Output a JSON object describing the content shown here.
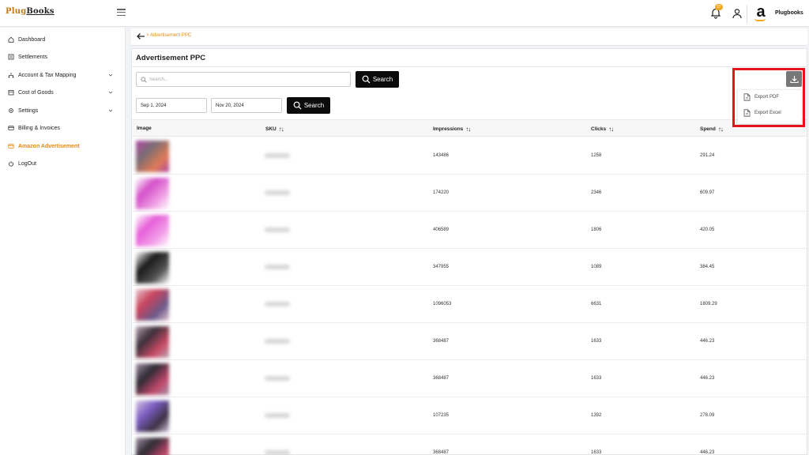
{
  "brand": {
    "name_part1": "Plug",
    "name_part2": "Books"
  },
  "header": {
    "notification_count": "27",
    "account_name": "Plugbooks",
    "amazon_letter": "a"
  },
  "sidebar": {
    "items": [
      {
        "label": "Dashboard",
        "icon": "home-icon",
        "has_chevron": false,
        "active": false
      },
      {
        "label": "Settlements",
        "icon": "receipt-icon",
        "has_chevron": false,
        "active": false
      },
      {
        "label": "Account & Tax Mapping",
        "icon": "sitemap-icon",
        "has_chevron": true,
        "active": false
      },
      {
        "label": "Cost of Goods",
        "icon": "box-icon",
        "has_chevron": true,
        "active": false
      },
      {
        "label": "Settings",
        "icon": "gear-icon",
        "has_chevron": true,
        "active": false
      },
      {
        "label": "Billing & Invoices",
        "icon": "card-icon",
        "has_chevron": false,
        "active": false
      },
      {
        "label": "Amazon Advertisement",
        "icon": "ad-icon",
        "has_chevron": false,
        "active": true
      },
      {
        "label": "LogOut",
        "icon": "power-icon",
        "has_chevron": false,
        "active": false
      }
    ]
  },
  "breadcrumb": {
    "label": "> Advertisement PPC"
  },
  "page": {
    "title": "Advertisement PPC"
  },
  "search": {
    "placeholder": "Search...",
    "value": "",
    "button_label": "Search"
  },
  "date_filter": {
    "start": "Sep 1, 2024",
    "end": "Nov 20, 2024",
    "button_label": "Search"
  },
  "table": {
    "columns": [
      {
        "label": "Image",
        "sortable": false
      },
      {
        "label": "SKU",
        "sortable": true
      },
      {
        "label": "Impressions",
        "sortable": true
      },
      {
        "label": "Clicks",
        "sortable": true
      },
      {
        "label": "Spend",
        "sortable": true
      }
    ],
    "rows": [
      {
        "impressions": "143486",
        "clicks": "1258",
        "spend": "291.24",
        "thumb_colors": [
          "#7a6d74",
          "#e07a55",
          "#b24aa5"
        ]
      },
      {
        "impressions": "174220",
        "clicks": "2346",
        "spend": "609.97",
        "thumb_colors": [
          "#d44fc8",
          "#f0a3e6",
          "#ffffff"
        ]
      },
      {
        "impressions": "406589",
        "clicks": "1806",
        "spend": "420.05",
        "thumb_colors": [
          "#e65fd8",
          "#f3a1ea",
          "#ffffff"
        ]
      },
      {
        "impressions": "347955",
        "clicks": "1089",
        "spend": "384.45",
        "thumb_colors": [
          "#1a1a1a",
          "#555555",
          "#ffffff"
        ]
      },
      {
        "impressions": "1096053",
        "clicks": "6631",
        "spend": "1809.29",
        "thumb_colors": [
          "#c9435c",
          "#6c5a8a",
          "#e6c6cf"
        ]
      },
      {
        "impressions": "368487",
        "clicks": "1633",
        "spend": "446.23",
        "thumb_colors": [
          "#3a2f3a",
          "#c74a63",
          "#bda6b6"
        ]
      },
      {
        "impressions": "368487",
        "clicks": "1633",
        "spend": "446.23",
        "thumb_colors": [
          "#2e2a33",
          "#c0486b",
          "#a592a8"
        ]
      },
      {
        "impressions": "107235",
        "clicks": "1392",
        "spend": "278.09",
        "thumb_colors": [
          "#7b5ec2",
          "#3c3142",
          "#d7c6e4"
        ]
      },
      {
        "impressions": "368487",
        "clicks": "1633",
        "spend": "446.23",
        "thumb_colors": [
          "#2e2a33",
          "#c0486b",
          "#a592a8"
        ]
      }
    ]
  },
  "export": {
    "items": [
      {
        "label": "Export PDF",
        "icon": "pdf-file-icon"
      },
      {
        "label": "Export Excel",
        "icon": "excel-file-icon"
      }
    ]
  },
  "colors": {
    "accent": "#e8880a",
    "highlight": "#e8121c",
    "dark_button": "#0b0b0b"
  }
}
